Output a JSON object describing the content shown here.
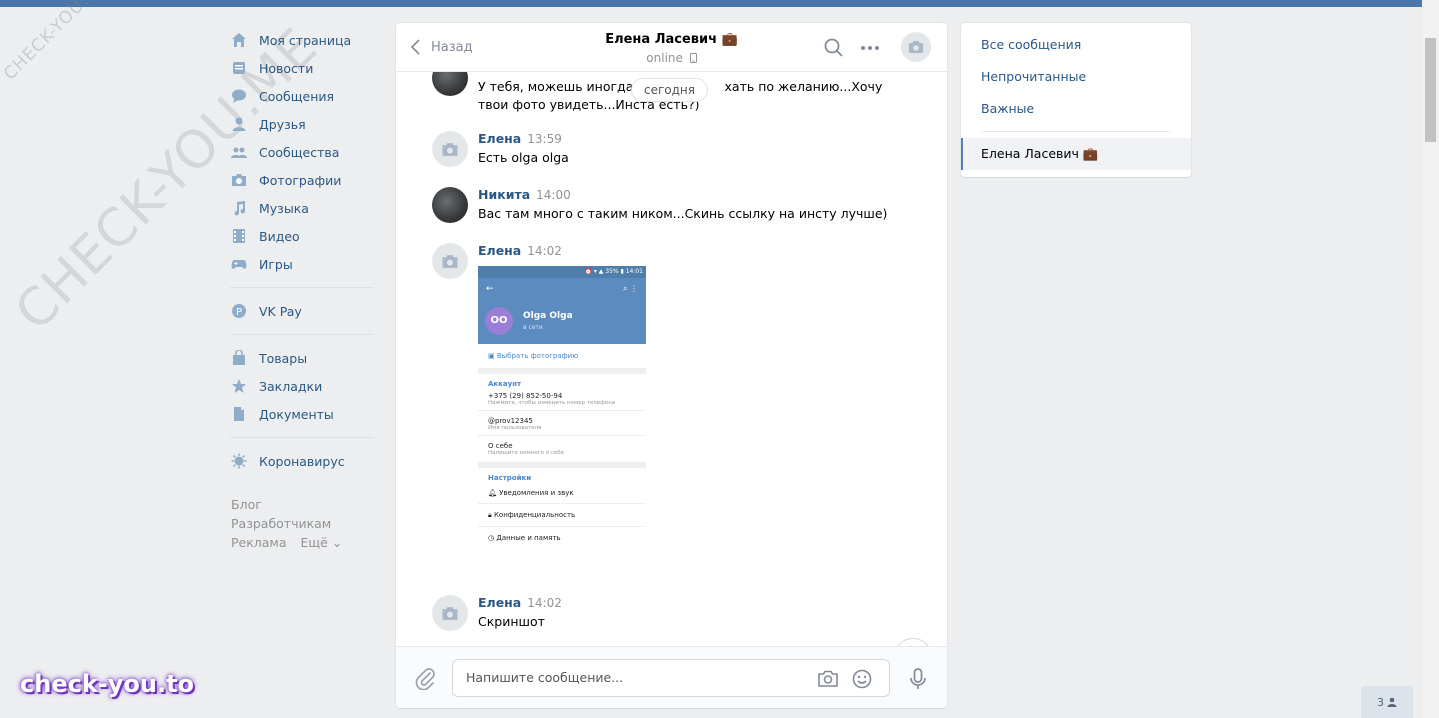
{
  "watermark": {
    "small": "CHECK-YOU.ME",
    "big": "CHECK-YOU.ME",
    "bottom": "check-you.to"
  },
  "nav": {
    "items": [
      {
        "label": "Моя страница",
        "icon": "home-icon"
      },
      {
        "label": "Новости",
        "icon": "news-icon"
      },
      {
        "label": "Сообщения",
        "icon": "messages-icon"
      },
      {
        "label": "Друзья",
        "icon": "friend-icon"
      },
      {
        "label": "Сообщества",
        "icon": "groups-icon"
      },
      {
        "label": "Фотографии",
        "icon": "camera-icon"
      },
      {
        "label": "Музыка",
        "icon": "music-icon"
      },
      {
        "label": "Видео",
        "icon": "video-icon"
      },
      {
        "label": "Игры",
        "icon": "gamepad-icon"
      }
    ],
    "pay": {
      "label": "VK Pay",
      "icon": "pay-icon"
    },
    "items2": [
      {
        "label": "Товары",
        "icon": "bag-icon"
      },
      {
        "label": "Закладки",
        "icon": "star-icon"
      },
      {
        "label": "Документы",
        "icon": "document-icon"
      }
    ],
    "corona": {
      "label": "Коронавирус",
      "icon": "virus-icon"
    },
    "footer": [
      "Блог",
      "Разработчикам",
      "Реклама",
      "Ещё ⌄"
    ]
  },
  "chat": {
    "back_label": "Назад",
    "title": "Елена Ласевич",
    "title_badge": "💼",
    "status": "online",
    "date_pill": "сегодня",
    "messages": [
      {
        "author": "",
        "time": "",
        "text": "У тебя, можешь иногда ко[...]хать по желанию...Хочу твои фото увидеть...Инста есть?)"
      },
      {
        "author": "Елена",
        "time": "13:59",
        "text": "Есть olga olga"
      },
      {
        "author": "Никита",
        "time": "14:00",
        "text": "Вас там много с таким ником...Скинь ссылку на инсту лучше)"
      },
      {
        "author": "Елена",
        "time": "14:02",
        "text": ""
      },
      {
        "author": "Елена",
        "time": "14:02",
        "text": "Скриншот"
      }
    ],
    "first_text_a": "У тебя, можешь иногда ко",
    "first_text_b": "хать по желанию...Хочу",
    "first_text_c": "твои фото увидеть...Инста есть?)",
    "screenshot": {
      "statusbar": "⏰ ▾ ▲ 35% ▮ 14:01",
      "avatar_initials": "OO",
      "name": "Olga Olga",
      "presence": "в сети",
      "choose_photo": "Выбрать фотографию",
      "account_header": "Аккаунт",
      "phone": "+375 (29) 852-50-94",
      "phone_hint": "Нажмите, чтобы изменить номер телефона",
      "username": "@prov12345",
      "username_hint": "Имя пользователя",
      "about": "О себе",
      "about_hint": "Напишите немного о себе",
      "settings_header": "Настройки",
      "settings": [
        "Уведомления и звук",
        "Конфиденциальность",
        "Данные и память"
      ]
    },
    "composer_placeholder": "Напишите сообщение..."
  },
  "right": {
    "items": [
      "Все сообщения",
      "Непрочитанные",
      "Важные"
    ],
    "active": "Елена Ласевич 💼"
  },
  "counter": "3"
}
